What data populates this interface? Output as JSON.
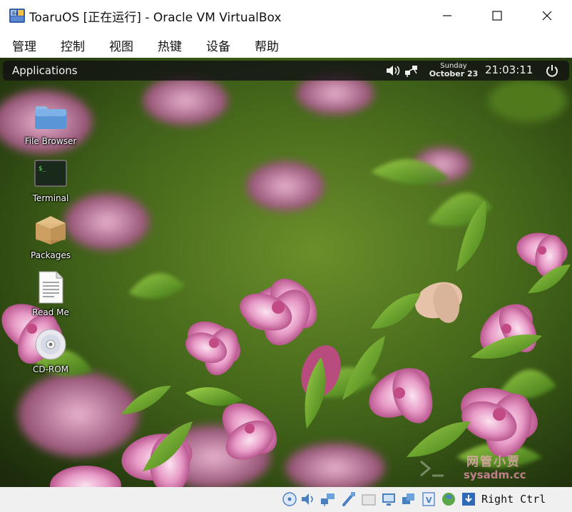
{
  "window": {
    "title": "ToaruOS [正在运行] - Oracle VM VirtualBox",
    "icon": "virtualbox-app-icon",
    "controls": [
      "minimize-icon",
      "maximize-icon",
      "close-icon"
    ]
  },
  "menubar": {
    "items": [
      "管理",
      "控制",
      "视图",
      "热键",
      "设备",
      "帮助"
    ]
  },
  "guest": {
    "panel": {
      "applications_label": "Applications",
      "date_day": "Sunday",
      "date_date": "October 23",
      "clock": "21:03:11",
      "icons": [
        "volume-icon",
        "network-icon",
        "power-icon"
      ]
    },
    "desktop_icons": [
      {
        "label": "File Browser",
        "icon": "folder-icon"
      },
      {
        "label": "Terminal",
        "icon": "terminal-icon"
      },
      {
        "label": "Packages",
        "icon": "package-box-icon"
      },
      {
        "label": "Read Me",
        "icon": "document-icon"
      },
      {
        "label": "CD-ROM",
        "icon": "cdrom-icon"
      }
    ],
    "watermark": {
      "line1": "网管小贾",
      "line2": "sysadm.cc"
    }
  },
  "statusbar": {
    "icons": [
      "optical-drive-icon",
      "audio-icon",
      "network-icon",
      "usb-icon",
      "shared-folders-icon",
      "display-icon",
      "video-capture-icon",
      "virtualization-icon",
      "mouse-integration-icon",
      "keyboard-capture-icon"
    ],
    "host_key": "Right Ctrl"
  },
  "colors": {
    "panel_bg": "#121212",
    "titlebar_bg": "#ffffff",
    "statusbar_bg": "#f0f0f0",
    "flower_pink": "#e7a1c8",
    "leaf_green": "#4f8a1f"
  }
}
